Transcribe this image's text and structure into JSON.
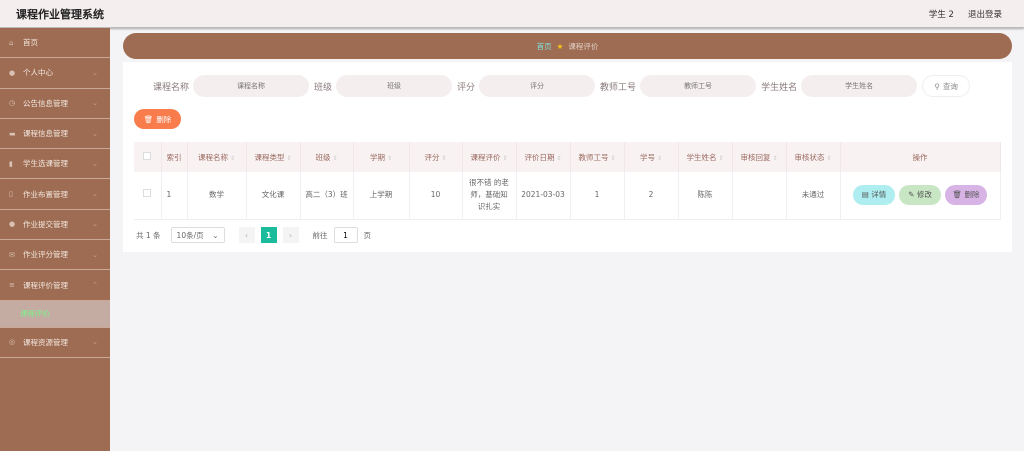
{
  "header": {
    "title": "课程作业管理系统",
    "user": "学生 2",
    "logout": "退出登录"
  },
  "sidebar": {
    "items": [
      {
        "label": "首页",
        "icon": "home-icon"
      },
      {
        "label": "个人中心",
        "icon": "user-icon"
      },
      {
        "label": "公告信息管理",
        "icon": "clock-icon"
      },
      {
        "label": "课程信息管理",
        "icon": "briefcase-icon"
      },
      {
        "label": "学生选课管理",
        "icon": "clipboard-icon"
      },
      {
        "label": "作业布置管理",
        "icon": "mic-icon"
      },
      {
        "label": "作业提交管理",
        "icon": "pin-icon"
      },
      {
        "label": "作业评分管理",
        "icon": "mail-icon"
      },
      {
        "label": "课程评价管理",
        "icon": "menu-icon"
      }
    ],
    "sub_item": "课程评价",
    "last_item": {
      "label": "课程资源管理",
      "icon": "compass-icon"
    }
  },
  "breadcrumb": {
    "home": "首页",
    "current": "课程评价"
  },
  "search": {
    "fields": [
      {
        "label": "课程名称",
        "placeholder": "课程名称"
      },
      {
        "label": "班级",
        "placeholder": "班级"
      },
      {
        "label": "评分",
        "placeholder": "评分"
      },
      {
        "label": "教师工号",
        "placeholder": "教师工号"
      },
      {
        "label": "学生姓名",
        "placeholder": "学生姓名"
      }
    ],
    "button": "查询"
  },
  "toolbar": {
    "delete": "删除"
  },
  "table": {
    "columns": [
      "索引",
      "课程名称",
      "课程类型",
      "班级",
      "学期",
      "评分",
      "课程评价",
      "评价日期",
      "教师工号",
      "学号",
      "学生姓名",
      "审核回复",
      "审核状态",
      "操作"
    ],
    "rows": [
      [
        "1",
        "数学",
        "文化课",
        "高二（3）班",
        "上学期",
        "10",
        "很不错 的老师，基础知识扎实",
        "2021-03-03",
        "1",
        "2",
        "陈陈",
        "",
        "未通过"
      ]
    ],
    "actions": {
      "detail": "详情",
      "edit": "修改",
      "delete": "删除"
    }
  },
  "pagination": {
    "total": "共 1 条",
    "page_size": "10条/页",
    "current": "1",
    "goto": "前往",
    "goto_value": "1",
    "page_unit": "页"
  },
  "colors": {
    "sidebar": "#9e6c52",
    "delete": "#f97c4c",
    "detail": "#aeeef0",
    "edit": "#c8e6c4",
    "remove": "#d7b3e6",
    "active_page": "#1abc9c"
  }
}
